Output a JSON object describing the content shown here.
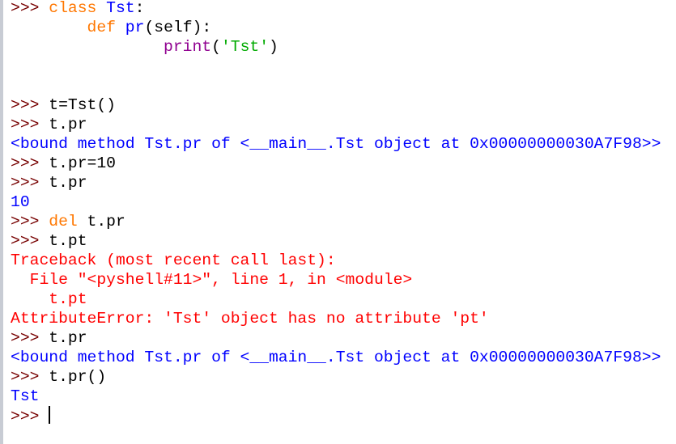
{
  "colors": {
    "prompt": "#770000",
    "keyword": "#ff7700",
    "definition": "#0000ff",
    "builtin": "#900090",
    "string": "#00aa00",
    "stdout": "#0000ff",
    "stderr": "#ff0000"
  },
  "lines": [
    [
      [
        "prompt",
        ">>> "
      ],
      [
        "keyword",
        "class"
      ],
      [
        "stdin",
        " "
      ],
      [
        "definition",
        "Tst"
      ],
      [
        "stdin",
        ":"
      ]
    ],
    [
      [
        "stdin",
        "        "
      ],
      [
        "keyword",
        "def"
      ],
      [
        "stdin",
        " "
      ],
      [
        "definition",
        "pr"
      ],
      [
        "stdin",
        "(self):"
      ]
    ],
    [
      [
        "stdin",
        "                "
      ],
      [
        "builtin",
        "print"
      ],
      [
        "stdin",
        "("
      ],
      [
        "string",
        "'Tst'"
      ],
      [
        "stdin",
        ")"
      ]
    ],
    [],
    [],
    [
      [
        "prompt",
        ">>> "
      ],
      [
        "stdin",
        "t=Tst()"
      ]
    ],
    [
      [
        "prompt",
        ">>> "
      ],
      [
        "stdin",
        "t.pr"
      ]
    ],
    [
      [
        "stdout",
        "<bound method Tst.pr of <__main__.Tst object at 0x00000000030A7F98>>"
      ]
    ],
    [
      [
        "prompt",
        ">>> "
      ],
      [
        "stdin",
        "t.pr=10"
      ]
    ],
    [
      [
        "prompt",
        ">>> "
      ],
      [
        "stdin",
        "t.pr"
      ]
    ],
    [
      [
        "stdout",
        "10"
      ]
    ],
    [
      [
        "prompt",
        ">>> "
      ],
      [
        "keyword",
        "del"
      ],
      [
        "stdin",
        " t.pr"
      ]
    ],
    [
      [
        "prompt",
        ">>> "
      ],
      [
        "stdin",
        "t.pt"
      ]
    ],
    [
      [
        "stderr",
        "Traceback (most recent call last):"
      ]
    ],
    [
      [
        "stderr",
        "  File \"<pyshell#11>\", line 1, in <module>"
      ]
    ],
    [
      [
        "stderr",
        "    t.pt"
      ]
    ],
    [
      [
        "stderr",
        "AttributeError: 'Tst' object has no attribute 'pt'"
      ]
    ],
    [
      [
        "prompt",
        ">>> "
      ],
      [
        "stdin",
        "t.pr"
      ]
    ],
    [
      [
        "stdout",
        "<bound method Tst.pr of <__main__.Tst object at 0x00000000030A7F98>>"
      ]
    ],
    [
      [
        "prompt",
        ">>> "
      ],
      [
        "stdin",
        "t.pr()"
      ]
    ],
    [
      [
        "stdout",
        "Tst"
      ]
    ],
    [
      [
        "prompt",
        ">>> "
      ]
    ]
  ]
}
